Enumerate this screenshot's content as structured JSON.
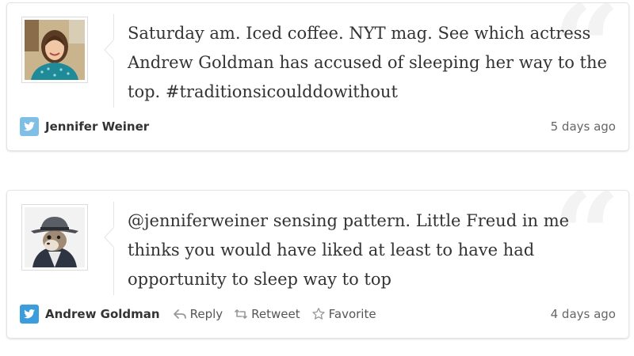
{
  "colors": {
    "twitter_blue": "#55acee",
    "text": "#333333",
    "muted": "#666666",
    "border": "#e3e3e3"
  },
  "tweets": [
    {
      "text": "Saturday am. Iced coffee. NYT mag. See which actress Andrew Goldman has accused of sleeping her way to the top. #traditionsicoulddowithout",
      "author": "Jennifer Weiner",
      "time": "5 days ago",
      "avatar_icon": "woman-portrait-avatar",
      "footer_icon": "twitter-bird-icon"
    },
    {
      "text": "@jenniferweiner sensing pattern. Little Freud in me thinks you would have liked at least to have had opportunity to sleep way to top",
      "author": "Andrew Goldman",
      "time": "4 days ago",
      "avatar_icon": "squirrel-in-fedora-avatar",
      "footer_icon": "twitter-bird-icon",
      "actions": {
        "reply": "Reply",
        "retweet": "Retweet",
        "favorite": "Favorite"
      }
    }
  ]
}
